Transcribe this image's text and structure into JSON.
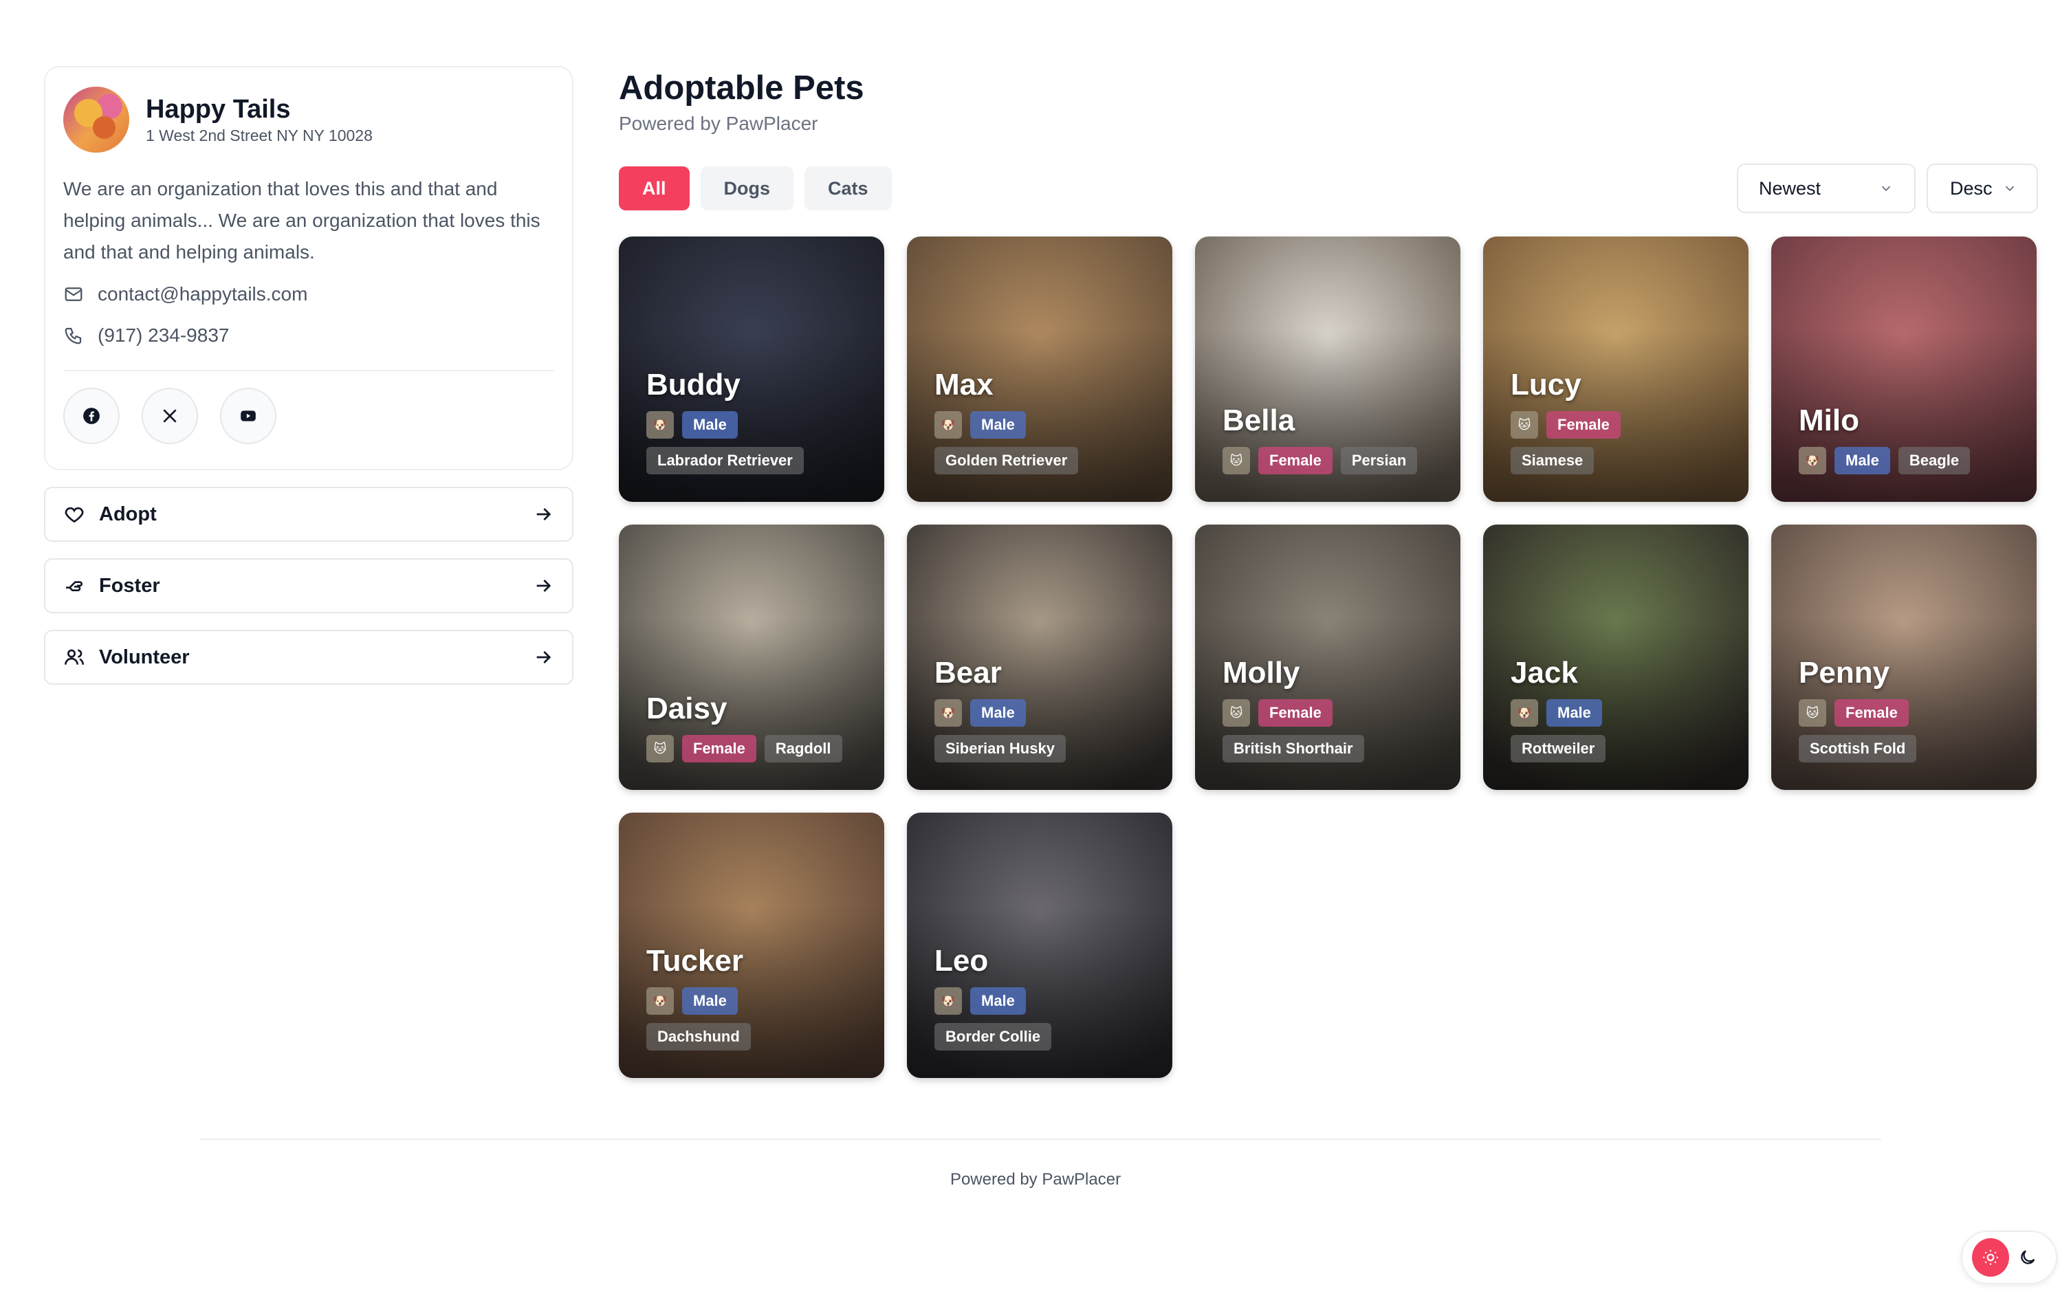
{
  "org": {
    "name": "Happy Tails",
    "address": "1 West 2nd Street NY NY 10028",
    "description": "We are an organization that loves this and that and helping animals... We are an organization that loves this and that and helping animals.",
    "email": "contact@happytails.com",
    "phone": "(917) 234-9837",
    "socials": [
      "facebook-icon",
      "x-icon",
      "youtube-icon"
    ]
  },
  "actions": [
    {
      "label": "Adopt",
      "icon": "heart-icon"
    },
    {
      "label": "Foster",
      "icon": "hand-icon"
    },
    {
      "label": "Volunteer",
      "icon": "users-icon"
    }
  ],
  "main": {
    "title": "Adoptable Pets",
    "subtitle": "Powered by PawPlacer",
    "filters": [
      {
        "label": "All",
        "active": true
      },
      {
        "label": "Dogs",
        "active": false
      },
      {
        "label": "Cats",
        "active": false
      }
    ],
    "sort": {
      "value": "Newest"
    },
    "direction": {
      "value": "Desc"
    }
  },
  "pets": [
    {
      "name": "Buddy",
      "species": "dog",
      "species_glyph": "🐶",
      "gender": "Male",
      "breed": "Labrador Retriever",
      "layout": "two-rows",
      "photo": [
        "#3a3f52",
        "#1c1e26"
      ]
    },
    {
      "name": "Max",
      "species": "dog",
      "species_glyph": "🐶",
      "gender": "Male",
      "breed": "Golden Retriever",
      "layout": "two-rows",
      "photo": [
        "#b08a60",
        "#5e4a36"
      ]
    },
    {
      "name": "Bella",
      "species": "cat",
      "species_glyph": "🐱",
      "gender": "Female",
      "breed": "Persian",
      "layout": "one-row",
      "photo": [
        "#d9d4cc",
        "#6e6458"
      ]
    },
    {
      "name": "Lucy",
      "species": "cat",
      "species_glyph": "🐱",
      "gender": "Female",
      "breed": "Siamese",
      "layout": "two-rows",
      "photo": [
        "#c7a36a",
        "#7a5c3a"
      ]
    },
    {
      "name": "Milo",
      "species": "dog",
      "species_glyph": "🐶",
      "gender": "Male",
      "breed": "Beagle",
      "layout": "one-row",
      "photo": [
        "#b86a6e",
        "#6a3a40"
      ]
    },
    {
      "name": "Daisy",
      "species": "cat",
      "species_glyph": "🐱",
      "gender": "Female",
      "breed": "Ragdoll",
      "layout": "one-row",
      "photo": [
        "#b8b0a0",
        "#4e4a44"
      ]
    },
    {
      "name": "Bear",
      "species": "dog",
      "species_glyph": "🐶",
      "gender": "Male",
      "breed": "Siberian Husky",
      "layout": "two-rows",
      "photo": [
        "#a89a88",
        "#3a3532"
      ]
    },
    {
      "name": "Molly",
      "species": "cat",
      "species_glyph": "🐱",
      "gender": "Female",
      "breed": "British Shorthair",
      "layout": "two-rows",
      "photo": [
        "#8c8478",
        "#45403a"
      ]
    },
    {
      "name": "Jack",
      "species": "dog",
      "species_glyph": "🐶",
      "gender": "Male",
      "breed": "Rottweiler",
      "layout": "two-rows",
      "photo": [
        "#6a7a4e",
        "#2e2a26"
      ]
    },
    {
      "name": "Penny",
      "species": "cat",
      "species_glyph": "🐱",
      "gender": "Female",
      "breed": "Scottish Fold",
      "layout": "two-rows",
      "photo": [
        "#b89c86",
        "#5c4c44"
      ]
    },
    {
      "name": "Tucker",
      "species": "dog",
      "species_glyph": "🐶",
      "gender": "Male",
      "breed": "Dachshund",
      "layout": "two-rows",
      "photo": [
        "#a8825c",
        "#5a4234"
      ]
    },
    {
      "name": "Leo",
      "species": "dog",
      "species_glyph": "🐶",
      "gender": "Male",
      "breed": "Border Collie",
      "layout": "two-rows",
      "photo": [
        "#6c6a70",
        "#2a2a30"
      ]
    }
  ],
  "footer": {
    "text": "Powered by PawPlacer"
  },
  "theme": {
    "accent": "#f43f5e",
    "icons": [
      "sun-icon",
      "moon-icon"
    ]
  }
}
